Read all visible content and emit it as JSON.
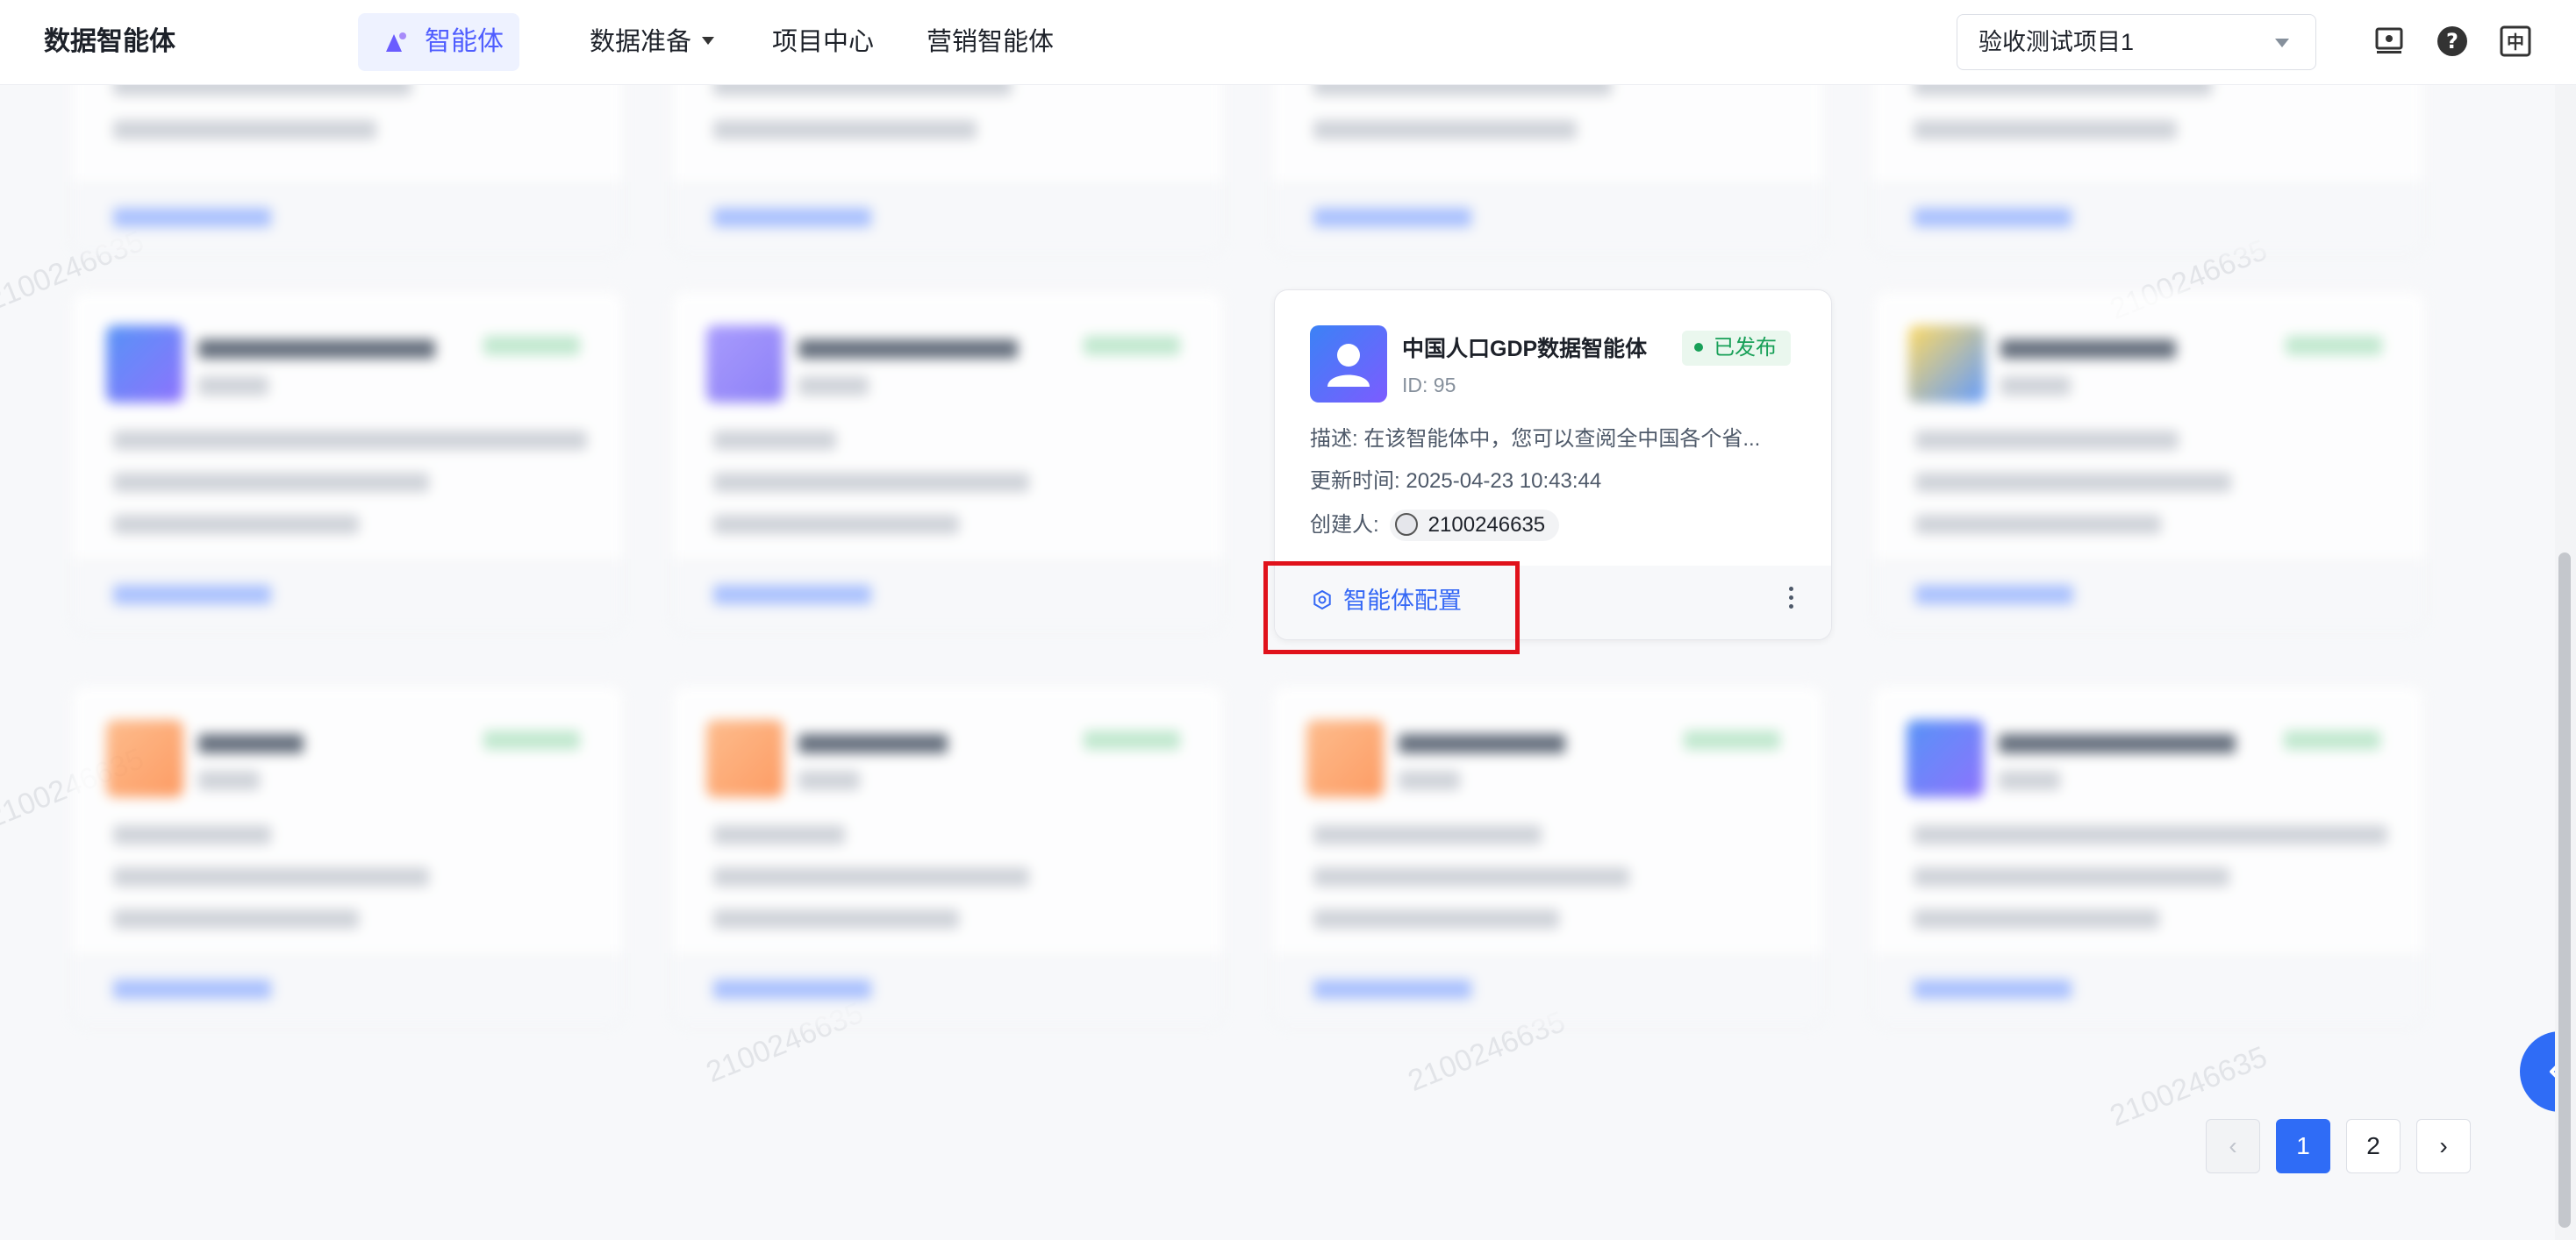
{
  "nav": {
    "brand": "数据智能体",
    "active_item": "智能体",
    "items": [
      "数据准备",
      "项目中心",
      "营销智能体"
    ],
    "project_select": "验收测试项目1"
  },
  "focused_card": {
    "title": "中国人口GDP数据智能体",
    "id_text": "ID: 95",
    "status": "已发布",
    "desc_label": "描述:",
    "desc": "在该智能体中，您可以查阅全中国各个省...",
    "updated_label": "更新时间:",
    "updated": "2025-04-23 10:43:44",
    "creator_label": "创建人:",
    "creator": "2100246635",
    "config_button": "智能体配置"
  },
  "pagination": {
    "prev": "‹",
    "pages": [
      "1",
      "2"
    ],
    "next": "›",
    "current": "1"
  },
  "watermark": "2100246635",
  "colors": {
    "accent": "#2f6cf6",
    "published_green": "#18a058",
    "highlight_red": "#e0121b"
  }
}
